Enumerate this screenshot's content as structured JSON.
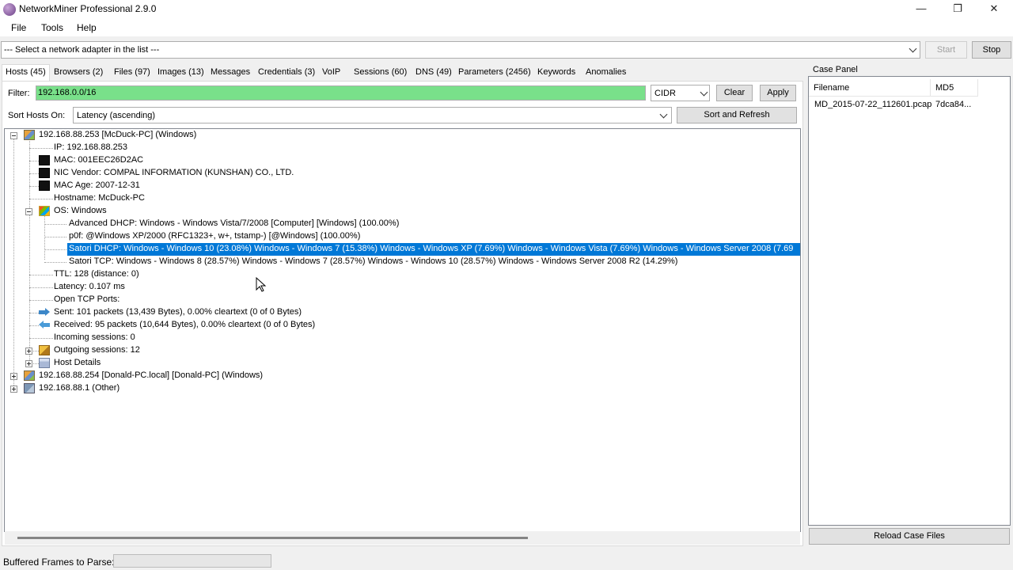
{
  "window": {
    "title": "NetworkMiner Professional 2.9.0",
    "minimize_glyph": "—",
    "maximize_glyph": "❐",
    "close_glyph": "✕",
    "icon": "networkminer-icon"
  },
  "menu": [
    "File",
    "Tools",
    "Help"
  ],
  "adapter": {
    "placeholder": "--- Select a network adapter in the list ---",
    "start_label": "Start",
    "stop_label": "Stop"
  },
  "tabs": [
    {
      "label": "Hosts (45)",
      "active": true
    },
    {
      "label": "Browsers (2)"
    },
    {
      "label": "Files (97)"
    },
    {
      "label": "Images (13)"
    },
    {
      "label": "Messages"
    },
    {
      "label": "Credentials (3)"
    },
    {
      "label": "VoIP"
    },
    {
      "label": "Sessions (60)"
    },
    {
      "label": "DNS (49)"
    },
    {
      "label": "Parameters (2456)"
    },
    {
      "label": "Keywords"
    },
    {
      "label": "Anomalies"
    }
  ],
  "filter": {
    "label": "Filter:",
    "value": "192.168.0.0/16",
    "mode": "CIDR",
    "clear_label": "Clear",
    "apply_label": "Apply",
    "highlight_color": "#79e08a"
  },
  "sort": {
    "label": "Sort Hosts On:",
    "value": "Latency (ascending)",
    "button_label": "Sort and Refresh"
  },
  "tree": {
    "host1": {
      "label": "192.168.88.253 [McDuck-PC] (Windows)",
      "ip": "IP: 192.168.88.253",
      "mac": "MAC: 001EEC26D2AC",
      "nic_vendor": "NIC Vendor: COMPAL INFORMATION (KUNSHAN) CO., LTD.",
      "mac_age": "MAC Age: 2007-12-31",
      "hostname": "Hostname: McDuck-PC",
      "os": "OS: Windows",
      "os_children": [
        "Advanced DHCP: Windows - Windows Vista/7/2008 [Computer] [Windows] (100.00%)",
        "p0f: @Windows XP/2000 (RFC1323+, w+, tstamp-) [@Windows] (100.00%)",
        "Satori DHCP: Windows - Windows 10 (23.08%) Windows - Windows 7 (15.38%) Windows - Windows XP (7.69%) Windows - Windows Vista (7.69%) Windows - Windows Server 2008 (7.69",
        "Satori TCP: Windows - Windows 8 (28.57%) Windows - Windows 7 (28.57%) Windows - Windows 10 (28.57%) Windows - Windows Server 2008 R2 (14.29%)"
      ],
      "ttl": "TTL: 128 (distance: 0)",
      "latency": "Latency: 0.107 ms",
      "open_tcp": "Open TCP Ports:",
      "sent": "Sent: 101 packets (13,439 Bytes), 0.00% cleartext (0 of 0 Bytes)",
      "received": "Received: 95 packets (10,644 Bytes), 0.00% cleartext (0 of 0 Bytes)",
      "incoming": "Incoming sessions: 0",
      "outgoing": "Outgoing sessions: 12",
      "details": "Host Details"
    },
    "host2": "192.168.88.254 [Donald-PC.local] [Donald-PC] (Windows)",
    "host3": "192.168.88.1 (Other)"
  },
  "case_panel": {
    "title": "Case Panel",
    "col_filename": "Filename",
    "col_md5": "MD5",
    "file": "MD_2015-07-22_112601.pcap",
    "md5": "7dca84...",
    "reload_label": "Reload Case Files"
  },
  "status": {
    "buffered_label": "Buffered Frames to Parse:"
  },
  "colors": {
    "selection": "#0078d7"
  }
}
